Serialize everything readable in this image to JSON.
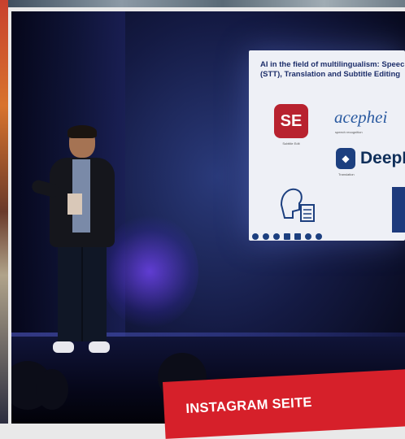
{
  "slide": {
    "title": "AI in the field of multilingualism: Speech-to-Text\n(STT), Translation and Subtitle Editing",
    "se_logo_text": "SE",
    "se_caption": "Subtitle Edit",
    "acephei_text": "acephei",
    "acephei_caption": "speech recognition",
    "deepl_text": "DeepL",
    "deepl_caption": "Translation"
  },
  "banner": {
    "label": "INSTAGRAM SEITE"
  },
  "colors": {
    "banner": "#d6202a",
    "slide_title": "#1d2e6a",
    "se_logo": "#b8222f",
    "stage_blue": "#141a43"
  },
  "icons": [
    "slide-toolbar-icons",
    "speech-to-text-icon"
  ]
}
